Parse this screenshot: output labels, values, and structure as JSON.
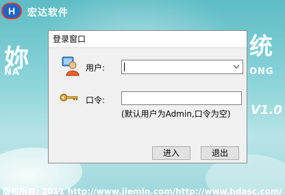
{
  "background": {
    "company_name": "宏达软件",
    "logo_letter": "H",
    "title_left": "妳",
    "title_right": "统",
    "subtitle_left": "NA",
    "subtitle_right": "ONG",
    "version": "V1.0",
    "footer": "版权所有: 2011    http://www.jiemin.com/http://www.hdasc.com/"
  },
  "dialog": {
    "title": "登录窗口",
    "user_label": "用户:",
    "user_value": "",
    "password_label": "口令:",
    "password_value": "",
    "hint": "(默认用户为Admin,口令为空)",
    "login_button": "进入",
    "exit_button": "退出"
  },
  "colors": {
    "background": "#6fc9cf",
    "dialog_bg": "#f0f0f0",
    "logo_blue": "#1e64c8",
    "logo_red": "#e53a2a"
  },
  "icons": [
    "user-icon",
    "key-icon",
    "chevron-down-icon"
  ]
}
